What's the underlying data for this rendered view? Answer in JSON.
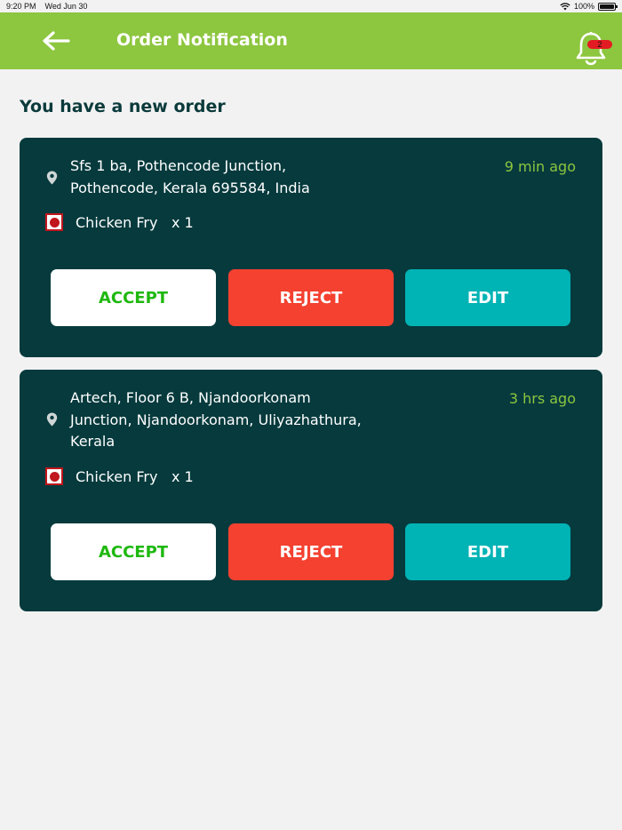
{
  "status_bar": {
    "time": "9:20 PM",
    "date": "Wed Jun 30",
    "battery": "100%"
  },
  "header": {
    "title": "Order Notification",
    "back_icon": "arrow-left-icon",
    "bell_icon": "bell-icon",
    "notification_count": "2"
  },
  "section_title": "You have a new order",
  "orders": [
    {
      "address_line1": "Sfs 1 ba, Pothencode Junction,",
      "address_line2": "Pothencode, Kerala 695584, India",
      "address_line3": "",
      "time_ago": "9 min ago",
      "item_name": "Chicken Fry",
      "item_qty": "x 1",
      "accept_label": "ACCEPT",
      "reject_label": "REJECT",
      "edit_label": "EDIT"
    },
    {
      "address_line1": "Artech, Floor 6 B, Njandoorkonam",
      "address_line2": "Junction, Njandoorkonam, Uliyazhathura,",
      "address_line3": "Kerala",
      "time_ago": "3 hrs ago",
      "item_name": "Chicken Fry",
      "item_qty": "x 1",
      "accept_label": "ACCEPT",
      "reject_label": "REJECT",
      "edit_label": "EDIT"
    }
  ],
  "colors": {
    "header_bg": "#8dc63f",
    "card_bg": "#063a3d",
    "accept_text": "#1fb80f",
    "reject_bg": "#f44130",
    "edit_bg": "#00b3b5",
    "time_text": "#8dc63f",
    "page_bg": "#f2f2f2"
  }
}
